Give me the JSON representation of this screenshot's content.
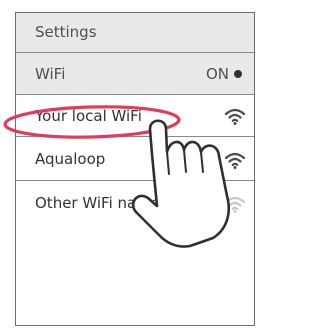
{
  "header": {
    "title": "Settings"
  },
  "wifi_row": {
    "label": "WiFi",
    "state": "ON",
    "enabled": true
  },
  "networks": [
    {
      "name": "Your local WiFi",
      "signal_icon": "wifi-signal-icon",
      "highlighted": true
    },
    {
      "name": "Aqualoop",
      "signal_icon": "wifi-signal-icon"
    },
    {
      "name": "Other WiFi name",
      "signal_icon": "wifi-signal-icon"
    }
  ],
  "annotation": {
    "highlight_color": "#e23b5a",
    "gesture_icon": "pointing-hand-icon"
  }
}
